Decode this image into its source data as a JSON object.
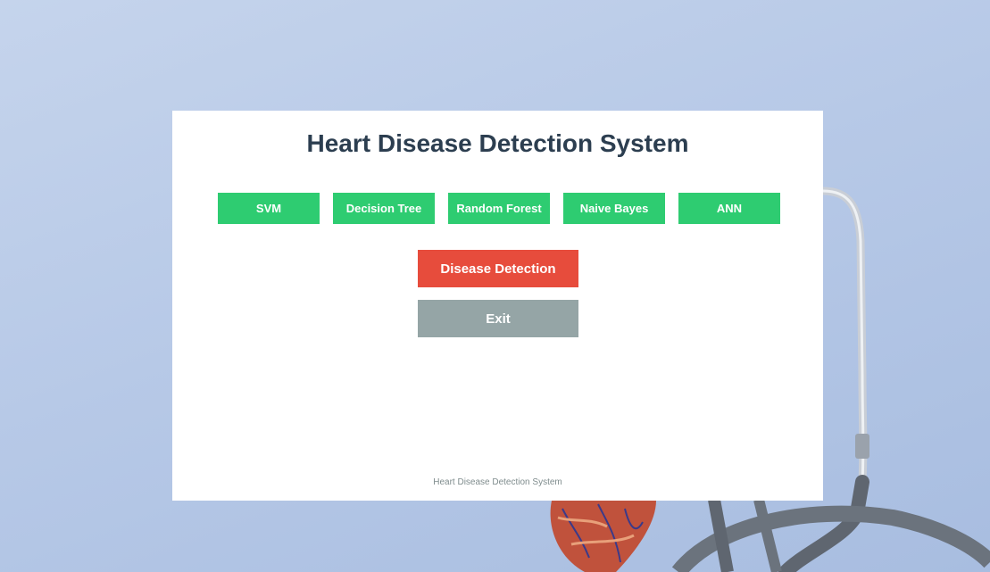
{
  "app": {
    "title": "Heart Disease Detection System"
  },
  "algorithms": [
    {
      "label": "SVM"
    },
    {
      "label": "Decision Tree"
    },
    {
      "label": "Random Forest"
    },
    {
      "label": "Naive Bayes"
    },
    {
      "label": "ANN"
    }
  ],
  "actions": {
    "detect_label": "Disease Detection",
    "exit_label": "Exit"
  },
  "footer": {
    "text": "Heart Disease Detection System"
  },
  "colors": {
    "algo_button": "#2ecc71",
    "detect_button": "#e74c3c",
    "exit_button": "#95a5a6",
    "title_text": "#2c3e50"
  }
}
